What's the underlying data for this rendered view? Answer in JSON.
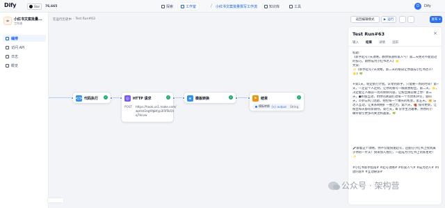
{
  "brand": {
    "name": "Dify",
    "github_label": "Star",
    "github_count": "76,665"
  },
  "nav": {
    "tabs": [
      {
        "label": "探索",
        "icon": "compass-icon"
      },
      {
        "label": "工作室",
        "icon": "grid-icon"
      },
      {
        "label": "知识库",
        "icon": "book-icon"
      },
      {
        "label": "工具",
        "icon": "wrench-icon"
      }
    ],
    "current_app": "小红书文案批量撰写工作流",
    "user_initial": "D",
    "user_name": "Dify"
  },
  "sidebar": {
    "app_name": "小红书文案批量...",
    "app_type": "工作流",
    "items": [
      {
        "label": "编排"
      },
      {
        "label": "访问 API"
      },
      {
        "label": "日志"
      },
      {
        "label": "概览"
      }
    ]
  },
  "canvas": {
    "breadcrumb": [
      "在运行历史中",
      "Test Run#63"
    ],
    "exit_label": "返回编辑模式",
    "run_label": "运行",
    "publish_label": "发布",
    "nodes": [
      {
        "title": "代码执行",
        "icon": "code-icon",
        "color": "#2e90fa"
      },
      {
        "title": "HTTP 请求",
        "icon": "globe-icon",
        "color": "#7a5af8",
        "method": "POST",
        "url_lines": [
          "https://hook.us1.make.com/",
          "wptsd1egt9gbfyp3l5f5b5h",
          "q7lkrvw"
        ]
      },
      {
        "title": "模板转换",
        "icon": "template-icon",
        "color": "#2e90fa"
      },
      {
        "title": "结束",
        "icon": "flag-icon",
        "color": "#f79009",
        "output_label": "模板转换",
        "output_var": "{x} output",
        "output_type": "String"
      }
    ]
  },
  "panel": {
    "title": "Test Run#63",
    "tabs": [
      "输入",
      "结果",
      "详情",
      "追踪"
    ],
    "active_tab": 1,
    "lines": [
      "标题:",
      "《新手起号7天攻略，教你快速积累人气！第二天绝对不能错过",
      "的技巧，助你成为小红书达人》🌟",
      "文案:",
      "✨《新手起号7天攻略，第二天的秘诀让你速成小红书达人！",
      "🌟》🍀",
      "",
      "☀第1天，制定执行计划。从零到新手，只需要一周的时间！第一",
      "天，一定是个人定制，让你的账号一眼就想粉丝。第二天，🌟，是",
      "决定能让人眼前一亮的新鲜内容，让粉丝眼前要上你！第三",
      "天，●积极互动，用你的真诚打动每一个点赞和评论，第四",
      "天，⊙参与热门话题，把控每一个曝光的机会，第五天，🌼 与",
      "达人互动，让关系网络扩一整之力。第六天，🍓 保持更新，让",
      "粉丝每天都有新期待。第七天，✿ 分享生活趣事，用你的小",
      "确幸吸引更多的关注和喜爱。🍀",
      "",
      "🎤跟着这个攻略，你不仅能快速起号，还能在小红书上找到属",
      "于你的一片天！快来加入我们，一起成为小红书上的新星吧！",
      "✨",
      "",
      "#小红书新手指南# #起号攻略# #积累人气# #成为达人# #播",
      "放内容# #互动秘诀#"
    ]
  },
  "watermark": "公众号 · 架构营"
}
